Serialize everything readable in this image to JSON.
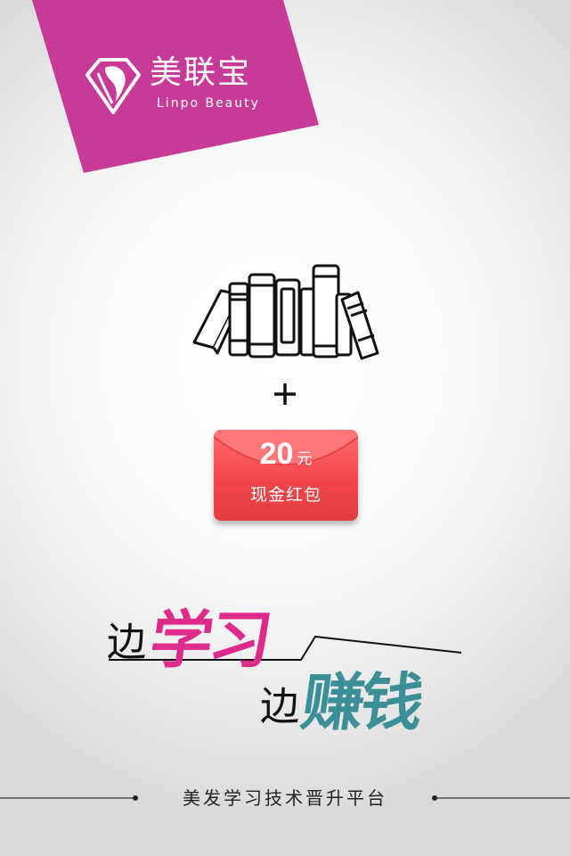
{
  "brand": {
    "name": "美联宝",
    "subtitle": "Linpo Beauty",
    "color": "#c83a98"
  },
  "envelope": {
    "amount": "20",
    "unit": "元",
    "label": "现金红包",
    "color": "#f2484b"
  },
  "slogan": {
    "bian1": "边",
    "xuexi": "学习",
    "bian2": "边",
    "zhuanqian": "赚钱",
    "pink": "#de2a8a",
    "teal": "#3d8f97"
  },
  "footer": {
    "text": "美发学习技术晋升平台"
  },
  "icons": [
    "brand-logo-icon",
    "books-icon",
    "plus-icon"
  ]
}
